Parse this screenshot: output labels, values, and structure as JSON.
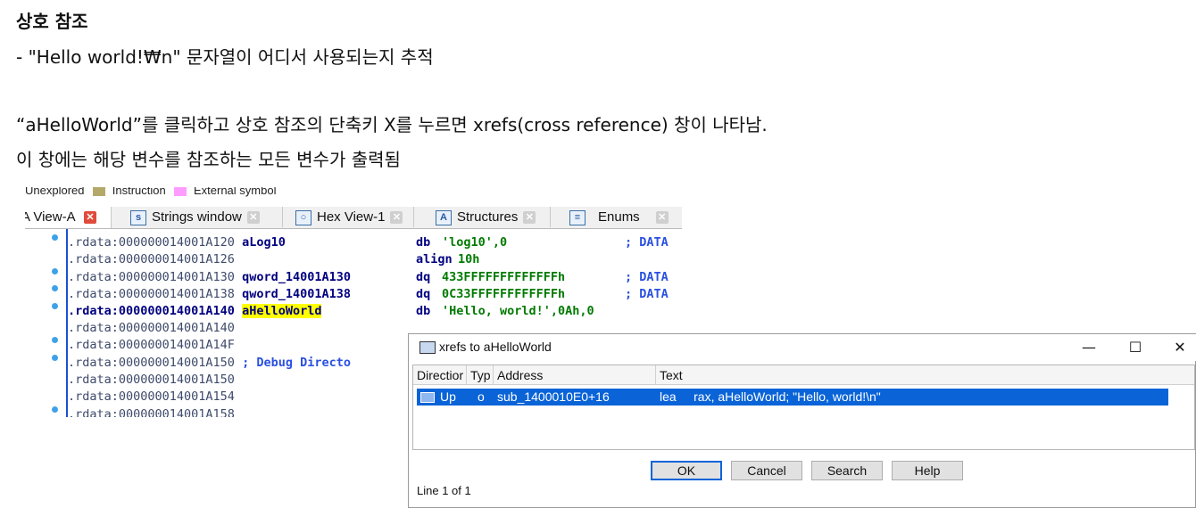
{
  "doc": {
    "heading": "상호 참조",
    "line1": "- \"Hello world!₩n\" 문자열이 어디서 사용되는지 추적",
    "line2": "“aHelloWorld”를 클릭하고 상호 참조의 단축키 X를 누르면 xrefs(cross reference) 창이 나타남.",
    "line3": "이 창에는 해당 변수를 참조하는 모든 변수가 출력됨"
  },
  "ida": {
    "legend": [
      {
        "label": "Unexplored",
        "color": ""
      },
      {
        "label": "Instruction",
        "color": "#b5a96a"
      },
      {
        "label": "External symbol",
        "color": "#ff9cff"
      }
    ],
    "tabs": [
      {
        "label": "A View-A",
        "icon": "ida-view-icon"
      },
      {
        "label": "Strings window",
        "icon": "strings-icon"
      },
      {
        "label": "Hex View-1",
        "icon": "hex-icon"
      },
      {
        "label": "Structures",
        "icon": "structures-icon"
      },
      {
        "label": "Enums",
        "icon": "enums-icon"
      }
    ],
    "lines": [
      {
        "addr": ".rdata:000000014001A120",
        "label": "aLog10",
        "instr": "db",
        "operand": "'log10',0",
        "comment": "; DATA"
      },
      {
        "addr": ".rdata:000000014001A126",
        "label": "",
        "instr": "align",
        "operand": "10h",
        "comment": ""
      },
      {
        "addr": ".rdata:000000014001A130",
        "label": "qword_14001A130",
        "instr": "dq",
        "operand": "433FFFFFFFFFFFFFh",
        "comment": "; DATA"
      },
      {
        "addr": ".rdata:000000014001A138",
        "label": "qword_14001A138",
        "instr": "dq",
        "operand": "0C33FFFFFFFFFFFFh",
        "comment": "; DATA"
      },
      {
        "addr": ".rdata:000000014001A140",
        "label": "aHelloWorld",
        "instr": "db",
        "operand": "'Hello, world!',0Ah,0",
        "comment": ""
      },
      {
        "addr": ".rdata:000000014001A140",
        "label": "",
        "instr": "",
        "operand": "",
        "comment": ""
      },
      {
        "addr": ".rdata:000000014001A14F",
        "label": "",
        "instr": "",
        "operand": "",
        "comment": ""
      },
      {
        "addr": ".rdata:000000014001A150",
        "label": "",
        "instr": "",
        "operand": "",
        "comment": "; Debug Directo"
      },
      {
        "addr": ".rdata:000000014001A150",
        "label": "",
        "instr": "",
        "operand": "",
        "comment": ""
      },
      {
        "addr": ".rdata:000000014001A154",
        "label": "",
        "instr": "",
        "operand": "",
        "comment": ""
      },
      {
        "addr": ".rdata:000000014001A158",
        "label": "",
        "instr": "",
        "operand": "",
        "comment": ""
      }
    ]
  },
  "xrefs": {
    "title": "xrefs to aHelloWorld",
    "window_buttons": {
      "minimize": "—",
      "maximize": "☐",
      "close": "✕"
    },
    "columns": [
      "Directior",
      "Typ",
      "Address",
      "Text"
    ],
    "rows": [
      {
        "direction": "Up",
        "type": "o",
        "address": "sub_1400010E0+16",
        "text": "lea     rax, aHelloWorld; \"Hello, world!\\n\""
      }
    ],
    "buttons": {
      "ok": "OK",
      "cancel": "Cancel",
      "search": "Search",
      "help": "Help"
    },
    "status": "Line 1 of 1"
  }
}
